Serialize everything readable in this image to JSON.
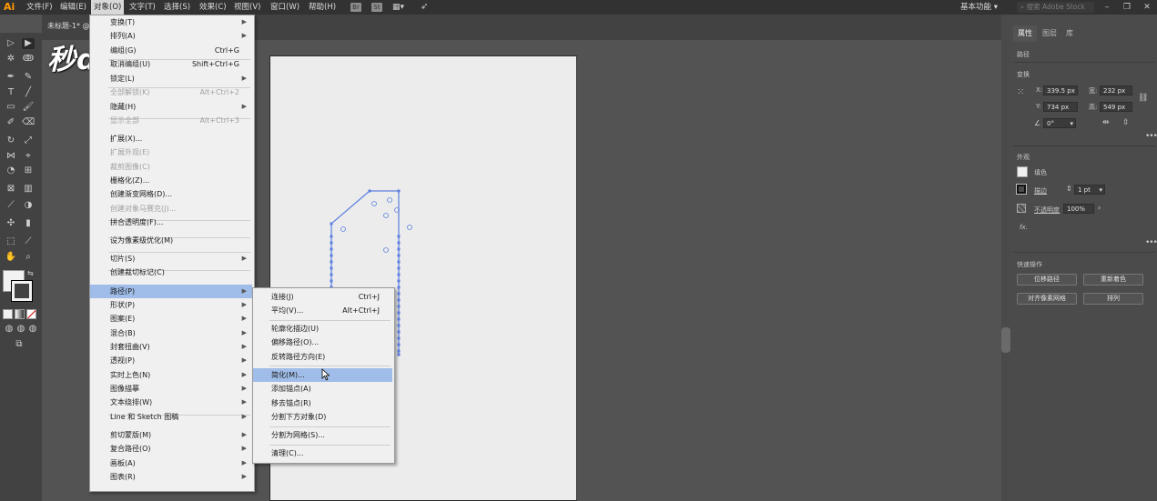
{
  "app": {
    "logo": "Ai"
  },
  "menubar": {
    "items": [
      "文件(F)",
      "编辑(E)",
      "对象(O)",
      "文字(T)",
      "选择(S)",
      "效果(C)",
      "视图(V)",
      "窗口(W)",
      "帮助(H)"
    ],
    "badges": [
      "Br",
      "St"
    ],
    "workspace": "基本功能",
    "search_placeholder": "搜索 Adobe Stock"
  },
  "document": {
    "tab_label": "未标题-1* @"
  },
  "watermark": "秒dong视频",
  "object_menu": {
    "items": [
      {
        "label": "变换(T)",
        "shortcut": "",
        "arrow": true,
        "disabled": false
      },
      {
        "label": "排列(A)",
        "shortcut": "",
        "arrow": true,
        "disabled": false
      },
      {
        "label": "编组(G)",
        "shortcut": "Ctrl+G",
        "arrow": false,
        "disabled": false
      },
      {
        "label": "取消编组(U)",
        "shortcut": "Shift+Ctrl+G",
        "arrow": false,
        "disabled": false
      },
      {
        "label": "锁定(L)",
        "shortcut": "",
        "arrow": true,
        "disabled": false
      },
      {
        "label": "全部解锁(K)",
        "shortcut": "Alt+Ctrl+2",
        "arrow": false,
        "disabled": true
      },
      {
        "label": "隐藏(H)",
        "shortcut": "",
        "arrow": true,
        "disabled": false
      },
      {
        "label": "显示全部",
        "shortcut": "Alt+Ctrl+3",
        "arrow": false,
        "disabled": true
      },
      {
        "label": "扩展(X)...",
        "shortcut": "",
        "arrow": false,
        "disabled": false
      },
      {
        "label": "扩展外观(E)",
        "shortcut": "",
        "arrow": false,
        "disabled": true
      },
      {
        "label": "裁剪图像(C)",
        "shortcut": "",
        "arrow": false,
        "disabled": true
      },
      {
        "label": "栅格化(Z)...",
        "shortcut": "",
        "arrow": false,
        "disabled": false
      },
      {
        "label": "创建渐变网格(D)...",
        "shortcut": "",
        "arrow": false,
        "disabled": false
      },
      {
        "label": "创建对象马赛克(J)...",
        "shortcut": "",
        "arrow": false,
        "disabled": true
      },
      {
        "label": "拼合透明度(F)...",
        "shortcut": "",
        "arrow": false,
        "disabled": false
      },
      {
        "label": "设为像素级优化(M)",
        "shortcut": "",
        "arrow": false,
        "disabled": false
      },
      {
        "label": "切片(S)",
        "shortcut": "",
        "arrow": true,
        "disabled": false
      },
      {
        "label": "创建裁切标记(C)",
        "shortcut": "",
        "arrow": false,
        "disabled": false
      },
      {
        "label": "路径(P)",
        "shortcut": "",
        "arrow": true,
        "disabled": false
      },
      {
        "label": "形状(P)",
        "shortcut": "",
        "arrow": true,
        "disabled": false
      },
      {
        "label": "图案(E)",
        "shortcut": "",
        "arrow": true,
        "disabled": false
      },
      {
        "label": "混合(B)",
        "shortcut": "",
        "arrow": true,
        "disabled": false
      },
      {
        "label": "封套扭曲(V)",
        "shortcut": "",
        "arrow": true,
        "disabled": false
      },
      {
        "label": "透视(P)",
        "shortcut": "",
        "arrow": true,
        "disabled": false
      },
      {
        "label": "实时上色(N)",
        "shortcut": "",
        "arrow": true,
        "disabled": false
      },
      {
        "label": "图像描摹",
        "shortcut": "",
        "arrow": true,
        "disabled": false
      },
      {
        "label": "文本绕排(W)",
        "shortcut": "",
        "arrow": true,
        "disabled": false
      },
      {
        "label": "Line 和 Sketch 图稿",
        "shortcut": "",
        "arrow": true,
        "disabled": false
      },
      {
        "label": "剪切蒙版(M)",
        "shortcut": "",
        "arrow": true,
        "disabled": false
      },
      {
        "label": "复合路径(O)",
        "shortcut": "",
        "arrow": true,
        "disabled": false
      },
      {
        "label": "画板(A)",
        "shortcut": "",
        "arrow": true,
        "disabled": false
      },
      {
        "label": "图表(R)",
        "shortcut": "",
        "arrow": true,
        "disabled": false
      }
    ]
  },
  "path_submenu": {
    "items": [
      {
        "label": "连接(J)",
        "shortcut": "Ctrl+J"
      },
      {
        "label": "平均(V)...",
        "shortcut": "Alt+Ctrl+J"
      },
      {
        "label": "轮廓化描边(U)",
        "shortcut": ""
      },
      {
        "label": "偏移路径(O)...",
        "shortcut": ""
      },
      {
        "label": "反转路径方向(E)",
        "shortcut": ""
      },
      {
        "label": "简化(M)...",
        "shortcut": ""
      },
      {
        "label": "添加锚点(A)",
        "shortcut": ""
      },
      {
        "label": "移去锚点(R)",
        "shortcut": ""
      },
      {
        "label": "分割下方对象(D)",
        "shortcut": ""
      },
      {
        "label": "分割为网格(S)...",
        "shortcut": ""
      },
      {
        "label": "清理(C)...",
        "shortcut": ""
      }
    ]
  },
  "properties_panel": {
    "tabs": [
      "属性",
      "图层",
      "库"
    ],
    "section_path": "路径",
    "section_transform": "变换",
    "x_label": "X:",
    "x_value": "339.5 px",
    "y_label": "Y:",
    "y_value": "734 px",
    "w_label": "宽:",
    "w_value": "232 px",
    "h_label": "高:",
    "h_value": "549 px",
    "angle_value": "0°",
    "section_appearance": "外观",
    "fill_label": "填色",
    "stroke_label": "描边",
    "stroke_value": "1 pt",
    "opacity_label": "不透明度",
    "opacity_value": "100%",
    "fx_label": "fx.",
    "section_quick": "快速操作",
    "btn_offset_path": "位移路径",
    "btn_recolor": "重新着色",
    "btn_align_pixel": "对齐像素网格",
    "btn_arrange": "排列"
  },
  "colors": {
    "menu_highlight": "#9fbde8",
    "path_stroke": "#5b7fe0",
    "panel_bg": "#4b4b4b"
  }
}
